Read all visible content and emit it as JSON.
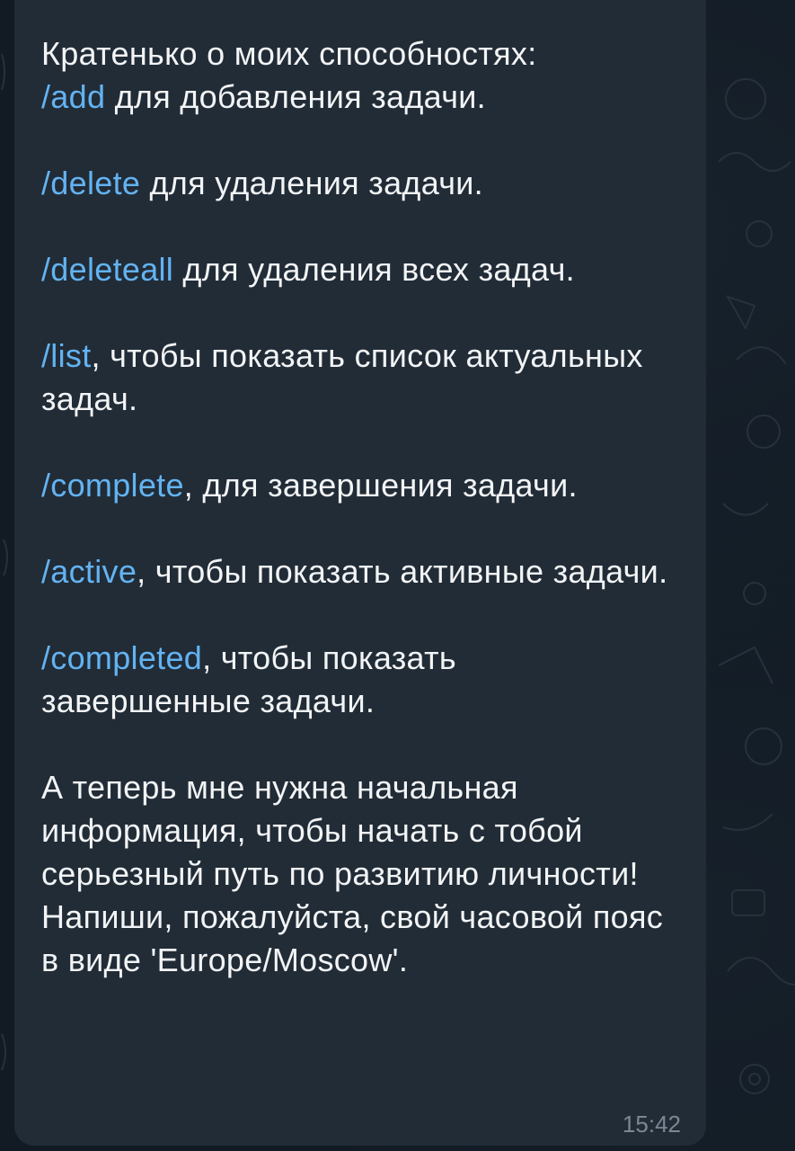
{
  "message": {
    "intro": "Кратенько о моих способностях:",
    "commands": [
      {
        "cmd": "/add",
        "text": " для добавления задачи."
      },
      {
        "cmd": "/delete",
        "text": " для удаления задачи."
      },
      {
        "cmd": "/deleteall",
        "text": " для удаления всех задач."
      },
      {
        "cmd": "/list",
        "text": ", чтобы показать список актуальных задач."
      },
      {
        "cmd": "/complete",
        "text": ", для завершения задачи."
      },
      {
        "cmd": "/active",
        "text": ", чтобы показать активные задачи."
      },
      {
        "cmd": "/completed",
        "text": ", чтобы показать завершенные задачи."
      }
    ],
    "closing": "А теперь мне нужна начальная информация, чтобы начать с тобой серьезный путь по развитию личности! Напиши, пожалуйста, свой часовой пояс в виде 'Europe/Moscow'.",
    "time": "15:42"
  },
  "colors": {
    "background": "#121b24",
    "bubble": "#222c36",
    "text": "#f2f4f6",
    "command_link": "#63b3f2",
    "timestamp": "#7b8794"
  }
}
